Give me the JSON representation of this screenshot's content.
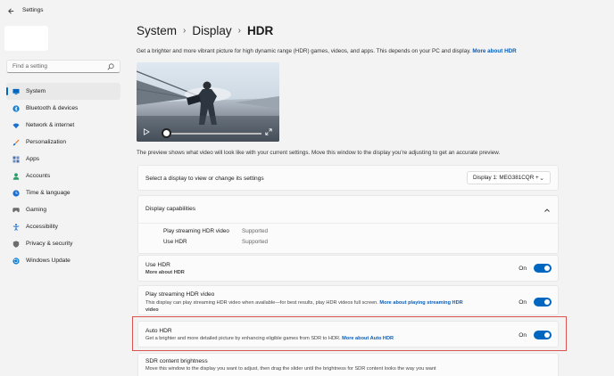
{
  "app": {
    "title": "Settings"
  },
  "search": {
    "placeholder": "Find a setting"
  },
  "nav": {
    "items": [
      {
        "label": "System",
        "icon": "monitor-icon",
        "color": "#0067c0"
      },
      {
        "label": "Bluetooth & devices",
        "icon": "bluetooth-icon",
        "color": "#0a7bd4"
      },
      {
        "label": "Network & internet",
        "icon": "wifi-icon",
        "color": "#1a6fd1"
      },
      {
        "label": "Personalization",
        "icon": "brush-icon",
        "color": "#e3762a"
      },
      {
        "label": "Apps",
        "icon": "apps-icon",
        "color": "#4b6fa8"
      },
      {
        "label": "Accounts",
        "icon": "person-icon",
        "color": "#2a9d6a"
      },
      {
        "label": "Time & language",
        "icon": "globe-clock-icon",
        "color": "#1a6fd1"
      },
      {
        "label": "Gaming",
        "icon": "gamepad-icon",
        "color": "#6c6c6c"
      },
      {
        "label": "Accessibility",
        "icon": "accessibility-icon",
        "color": "#1a6fd1"
      },
      {
        "label": "Privacy & security",
        "icon": "shield-icon",
        "color": "#6c6c6c"
      },
      {
        "label": "Windows Update",
        "icon": "update-icon",
        "color": "#0a7bd4"
      }
    ]
  },
  "breadcrumb": {
    "part1": "System",
    "part2": "Display",
    "current": "HDR"
  },
  "intro": {
    "text": "Get a brighter and more vibrant picture for high dynamic range (HDR) games, videos, and apps. This depends on your PC and display.",
    "link": "More about HDR"
  },
  "preview_note": "The preview shows what video will look like with your current settings. Move this window to the display you're adjusting to get an accurate preview.",
  "display_select": {
    "label": "Select a display to view or change its settings",
    "value": "Display 1: MEG381CQR +"
  },
  "capabilities": {
    "title": "Display capabilities",
    "rows": [
      {
        "label": "Play streaming HDR video",
        "value": "Supported"
      },
      {
        "label": "Use HDR",
        "value": "Supported"
      }
    ]
  },
  "use_hdr": {
    "title": "Use HDR",
    "link": "More about HDR",
    "state": "On"
  },
  "streaming": {
    "title": "Play streaming HDR video",
    "desc": "This display can play streaming HDR video when available—for best results, play HDR videos full screen.",
    "link1": "More about playing streaming HDR",
    "link2": "video",
    "state": "On"
  },
  "auto_hdr": {
    "title": "Auto HDR",
    "desc": "Get a brighter and more detailed picture by enhancing eligible games from SDR to HDR.",
    "link": "More about Auto HDR",
    "state": "On"
  },
  "sdr": {
    "title": "SDR content brightness",
    "desc": "Move this window to the display you want to adjust, then drag the slider until the brightness for SDR content looks the way you want"
  },
  "colors": {
    "accent": "#0067c0",
    "link": "#0a5eb8",
    "highlight": "#d9534f"
  }
}
